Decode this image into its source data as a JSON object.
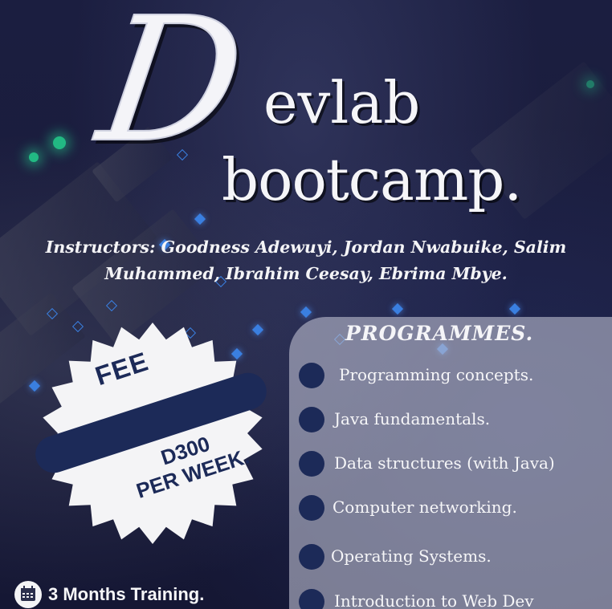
{
  "title": {
    "initial": "D",
    "word_line1": "evlab",
    "word_line2": "bootcamp."
  },
  "instructors": {
    "text": "Instructors: Goodness Adewuyi, Jordan Nwabuike, Salim Muhammed, Ibrahim Ceesay, Ebrima Mbye."
  },
  "fee": {
    "label": "FEE",
    "amount": "D300",
    "period": "PER WEEK."
  },
  "programmes": {
    "heading": "PROGRAMMES.",
    "items": [
      {
        "label": "Programming concepts."
      },
      {
        "label": "Java fundamentals."
      },
      {
        "label": "Data structures (with Java)"
      },
      {
        "label": "Computer networking."
      },
      {
        "label": "Operating Systems."
      },
      {
        "label": "Introduction to Web Dev"
      }
    ]
  },
  "duration": {
    "icon": "calendar-icon",
    "text": "3 Months Training."
  },
  "colors": {
    "background": "#171a3a",
    "navy": "#1c2a58",
    "panel": "#b9bccd",
    "text": "#f6f6f8",
    "accent_blue": "#3a7fe0",
    "accent_green": "#24d58f"
  }
}
